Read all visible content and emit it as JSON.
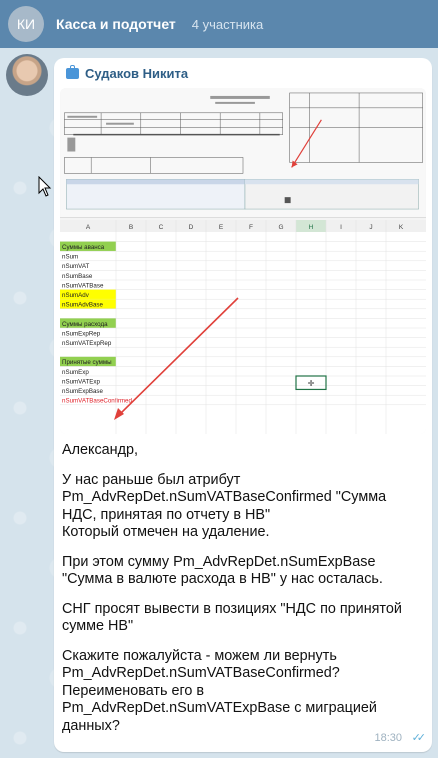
{
  "header": {
    "avatar_initials": "КИ",
    "title": "Касса и подотчет",
    "subtitle": "4 участника"
  },
  "message": {
    "sender": "Судаков Никита",
    "time": "18:30",
    "paragraphs": [
      "Александр,",
      "У нас раньше был атрибут Pm_AdvRepDet.nSumVATBaseConfirmed \"Сумма НДС, принятая по отчету в НВ\"\nКоторый отмечен на удаление.",
      "При этом сумму Pm_AdvRepDet.nSumExpBase \"Сумма в валюте расхода в НВ\" у нас осталась.",
      "СНГ просят вывести в позициях \"НДС по принятой сумме НВ\"",
      "Скажите пожалуйста - можем ли вернуть Pm_AdvRepDet.nSumVATBaseConfirmed?\nПереименовать его в Pm_AdvRepDet.nSumVATExpBase с миграцией данных?"
    ]
  },
  "spreadsheet": {
    "columns": [
      "A",
      "B",
      "C",
      "D",
      "E",
      "F",
      "G",
      "H",
      "I",
      "J",
      "K"
    ],
    "rows": [
      {
        "text": "",
        "style": "blank"
      },
      {
        "text": "Суммы аванса",
        "style": "green"
      },
      {
        "text": "nSum",
        "style": "plain"
      },
      {
        "text": "nSumVAT",
        "style": "plain"
      },
      {
        "text": "nSumBase",
        "style": "plain"
      },
      {
        "text": "nSumVATBase",
        "style": "plain"
      },
      {
        "text": "nSumAdv",
        "style": "yellow"
      },
      {
        "text": "nSumAdvBase",
        "style": "yellow"
      },
      {
        "text": "",
        "style": "blank"
      },
      {
        "text": "Суммы расхода",
        "style": "green"
      },
      {
        "text": "nSumExpRep",
        "style": "plain"
      },
      {
        "text": "nSumVATExpRep",
        "style": "plain"
      },
      {
        "text": "",
        "style": "blank"
      },
      {
        "text": "Принятые суммы",
        "style": "green"
      },
      {
        "text": "nSumExp",
        "style": "plain"
      },
      {
        "text": "nSumVATExp",
        "style": "plain"
      },
      {
        "text": "nSumExpBase",
        "style": "plain"
      },
      {
        "text": "nSumVATBaseConfirmed",
        "style": "red"
      }
    ],
    "colors": {
      "green": "#92d050",
      "yellow": "#ffff00",
      "red": "#e0232b",
      "arrow": "#e0403a"
    }
  }
}
